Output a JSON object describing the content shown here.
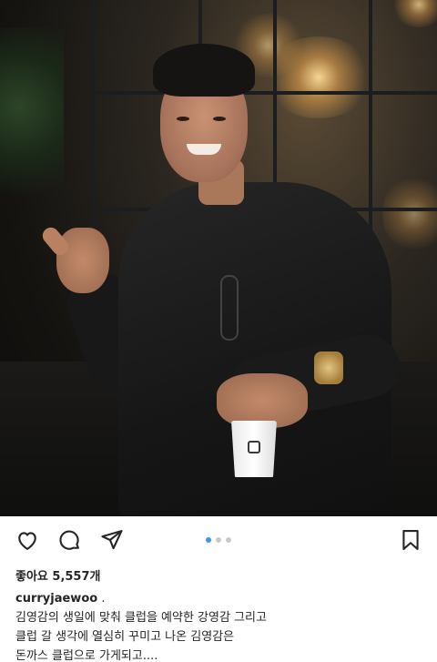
{
  "post": {
    "likes_text": "좋아요 5,557개",
    "username": "curryjaewoo",
    "username_suffix": " .",
    "caption_lines": [
      "김영감의 생일에 맞춰 클럽을 예약한 강영감 그리고",
      "클럽 갈 생각에 열심히 꾸미고 나온 김영감은",
      "돈까스 클럽으로 가게되고...."
    ],
    "carousel": {
      "count": 3,
      "active_index": 0
    }
  },
  "actions": {
    "like_icon": "heart-outline-icon",
    "comment_icon": "comment-bubble-icon",
    "share_icon": "paper-plane-icon",
    "save_icon": "bookmark-outline-icon"
  },
  "colors": {
    "text": "#262626",
    "carousel_active": "#3897f0",
    "carousel_inactive": "#c9c9c9"
  }
}
